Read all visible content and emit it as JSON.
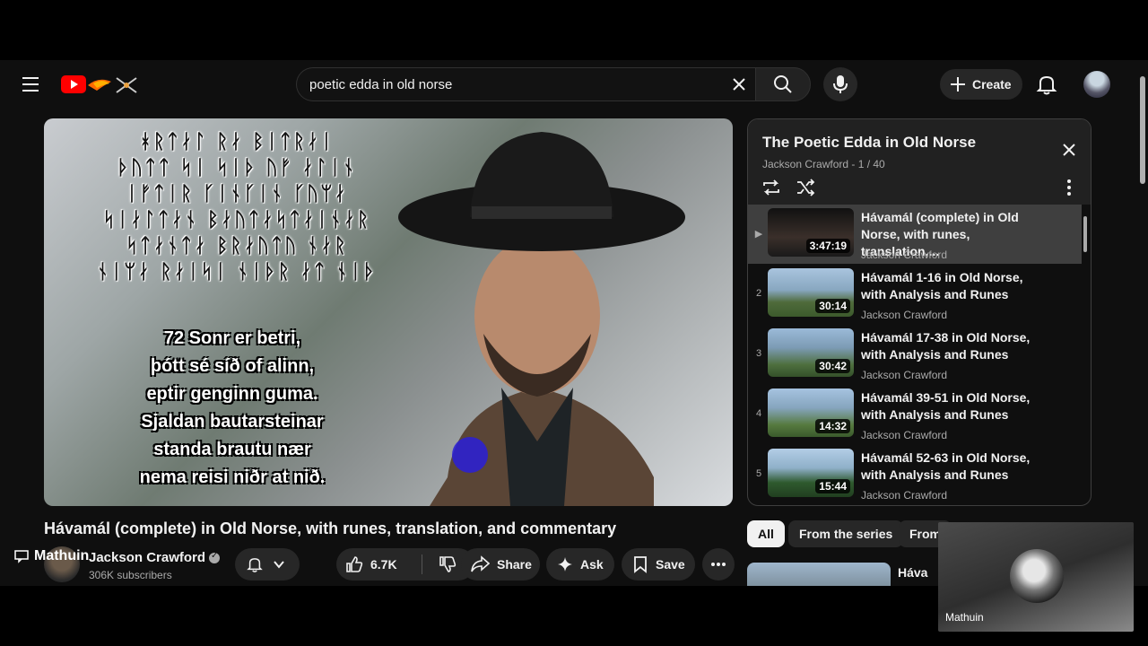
{
  "search": {
    "value": "poetic edda in old norse"
  },
  "header": {
    "create_label": "Create"
  },
  "video": {
    "runes": [
      "ᚼᚱᛏᛅᛚ ᚱᛅ ᛒᛁᛏᚱᛅᛁ",
      "ᚦᚢᛏᛏ ᛋᛁ ᛋᛁᚦ ᚢᚠ ᛅᛚᛁᚾ",
      "ᛁᚠᛏᛁᚱ ᚴᛁᚾᚴᛁᚾ ᚴᚢᛘᛅ",
      "ᛋᛁᛅᛚᛏᛅᚾ ᛒᛅᚢᛏᛅᛋᛏᛅᛁᚾᛅᚱ",
      "ᛋᛏᛅᚾᛏᛅ ᛒᚱᛅᚢᛏᚢ ᚾᛅᚱ",
      "ᚾᛁᛘᛅ ᚱᛅᛁᛋᛁ ᚾᛁᚦᚱ ᛅᛏ ᚾᛁᚦ"
    ],
    "verse": [
      "72 Sonr er betri,",
      "þótt sé síð of alinn,",
      "eptir genginn guma.",
      "Sjaldan bautarsteinar",
      "standa brautu nær",
      "nema reisi niðr at nið."
    ],
    "title": "Hávamál (complete) in Old Norse, with runes, translation, and commentary"
  },
  "channel": {
    "name": "Jackson Crawford",
    "subscribers": "306K subscribers"
  },
  "actions": {
    "likes": "6.7K",
    "share": "Share",
    "ask": "Ask",
    "save": "Save"
  },
  "overlay": {
    "chat_user": "Mathuin",
    "webcam_name": "Mathuin"
  },
  "playlist": {
    "title": "The Poetic Edda in Old Norse",
    "subtitle": "Jackson Crawford - 1 / 40",
    "items": [
      {
        "index": "▶",
        "title": "Hávamál (complete) in Old Norse, with runes, translation,...",
        "channel": "Jackson Crawford",
        "duration": "3:47:19"
      },
      {
        "index": "2",
        "title": "Hávamál 1-16 in Old Norse, with Analysis and Runes",
        "channel": "Jackson Crawford",
        "duration": "30:14"
      },
      {
        "index": "3",
        "title": "Hávamál 17-38 in Old Norse, with Analysis and Runes",
        "channel": "Jackson Crawford",
        "duration": "30:42"
      },
      {
        "index": "4",
        "title": "Hávamál 39-51 in Old Norse, with Analysis and Runes",
        "channel": "Jackson Crawford",
        "duration": "14:32"
      },
      {
        "index": "5",
        "title": "Hávamál 52-63 in Old Norse, with Analysis and Runes",
        "channel": "Jackson Crawford",
        "duration": "15:44"
      }
    ]
  },
  "chips": [
    "All",
    "From the series",
    "From"
  ],
  "recommendation": {
    "title": "Háva"
  },
  "colors": {
    "background": "#0f0f0f",
    "brand_red": "#ff0000",
    "chip_active": "#f1f1f1"
  }
}
